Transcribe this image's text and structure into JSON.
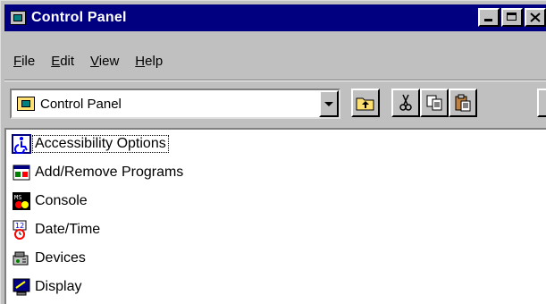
{
  "window": {
    "title": "Control Panel",
    "caption_buttons": [
      "minimize",
      "maximize",
      "close"
    ]
  },
  "menu": [
    {
      "label": "File",
      "accel": "F",
      "rest": "ile"
    },
    {
      "label": "Edit",
      "accel": "E",
      "rest": "dit"
    },
    {
      "label": "View",
      "accel": "V",
      "rest": "iew"
    },
    {
      "label": "Help",
      "accel": "H",
      "rest": "elp"
    }
  ],
  "toolbar": {
    "address_value": "Control Panel",
    "buttons": [
      "up-one-level",
      "cut",
      "copy",
      "paste"
    ]
  },
  "items": [
    {
      "label": "Accessibility Options",
      "icon": "accessibility-icon",
      "selected": true
    },
    {
      "label": "Add/Remove Programs",
      "icon": "add-remove-programs-icon",
      "selected": false
    },
    {
      "label": "Console",
      "icon": "console-icon",
      "selected": false
    },
    {
      "label": "Date/Time",
      "icon": "date-time-icon",
      "selected": false
    },
    {
      "label": "Devices",
      "icon": "devices-icon",
      "selected": false
    },
    {
      "label": "Display",
      "icon": "display-icon",
      "selected": false
    }
  ],
  "colors": {
    "titlebar": "#000080",
    "face": "#c0c0c0",
    "window_bg": "#ffffff"
  }
}
